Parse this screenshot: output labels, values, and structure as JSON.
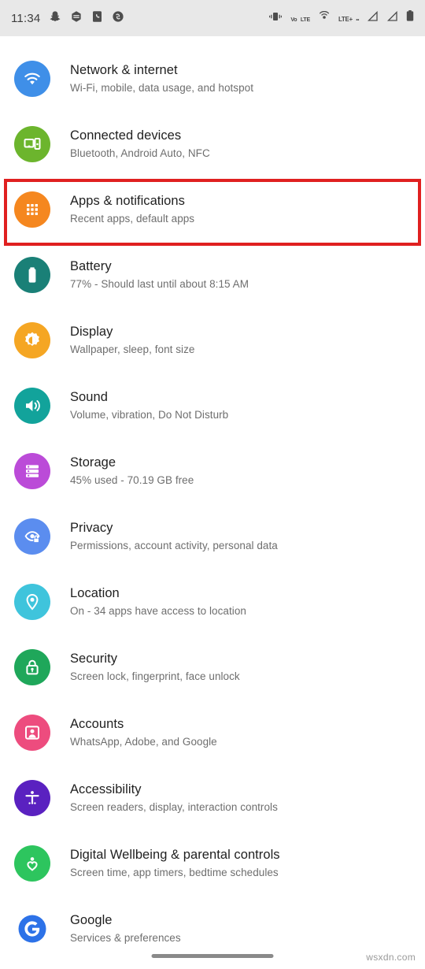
{
  "status_bar": {
    "time": "11:34",
    "left_icons": [
      "snapchat-icon",
      "hexagon-app-icon",
      "phone-app-icon",
      "shazam-icon"
    ],
    "right_icons": [
      "vibrate-icon",
      "volte-icon",
      "hotspot-icon",
      "lte-plus-icon",
      "signal-bars-1-icon",
      "signal-bars-2-icon",
      "battery-icon"
    ],
    "volte_label_top": "Vo",
    "volte_label_bottom": "LTE",
    "lte_label": "LTE+",
    "lte_sub": "••"
  },
  "settings": {
    "items": [
      {
        "title": "Network & internet",
        "subtitle": "Wi-Fi, mobile, data usage, and hotspot",
        "icon": "wifi-icon",
        "color": "#3F8FE8",
        "highlighted": false
      },
      {
        "title": "Connected devices",
        "subtitle": "Bluetooth, Android Auto, NFC",
        "icon": "connected-devices-icon",
        "color": "#6CB52D",
        "highlighted": false
      },
      {
        "title": "Apps & notifications",
        "subtitle": "Recent apps, default apps",
        "icon": "apps-grid-icon",
        "color": "#F5871F",
        "highlighted": true
      },
      {
        "title": "Battery",
        "subtitle": "77% - Should last until about 8:15 AM",
        "icon": "battery-icon",
        "color": "#1A8077",
        "highlighted": false
      },
      {
        "title": "Display",
        "subtitle": "Wallpaper, sleep, font size",
        "icon": "brightness-icon",
        "color": "#F5A623",
        "highlighted": false
      },
      {
        "title": "Sound",
        "subtitle": "Volume, vibration, Do Not Disturb",
        "icon": "speaker-icon",
        "color": "#12A39B",
        "highlighted": false
      },
      {
        "title": "Storage",
        "subtitle": "45% used - 70.19 GB free",
        "icon": "storage-icon",
        "color": "#BB4BD8",
        "highlighted": false
      },
      {
        "title": "Privacy",
        "subtitle": "Permissions, account activity, personal data",
        "icon": "privacy-eye-lock-icon",
        "color": "#5B8DEF",
        "highlighted": false
      },
      {
        "title": "Location",
        "subtitle": "On - 34 apps have access to location",
        "icon": "location-pin-icon",
        "color": "#3FC4DC",
        "highlighted": false
      },
      {
        "title": "Security",
        "subtitle": "Screen lock, fingerprint, face unlock",
        "icon": "lock-icon",
        "color": "#1FA75A",
        "highlighted": false
      },
      {
        "title": "Accounts",
        "subtitle": "WhatsApp, Adobe, and Google",
        "icon": "account-icon",
        "color": "#ED4C7E",
        "highlighted": false
      },
      {
        "title": "Accessibility",
        "subtitle": "Screen readers, display, interaction controls",
        "icon": "accessibility-icon",
        "color": "#5A21C0",
        "highlighted": false
      },
      {
        "title": "Digital Wellbeing & parental controls",
        "subtitle": "Screen time, app timers, bedtime schedules",
        "icon": "digital-wellbeing-icon",
        "color": "#2DC55E",
        "highlighted": false
      },
      {
        "title": "Google",
        "subtitle": "Services & preferences",
        "icon": "google-g-icon",
        "color": "#ffffff",
        "highlighted": false
      }
    ]
  },
  "highlight": {
    "color": "#E02020",
    "target": "Apps & notifications"
  },
  "watermark": "wsxdn.com"
}
